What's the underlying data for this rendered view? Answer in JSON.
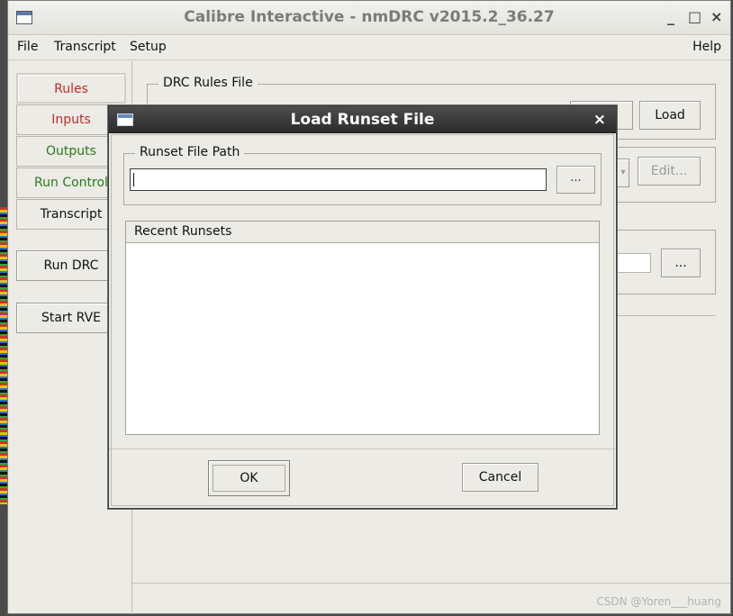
{
  "window": {
    "title": "Calibre Interactive - nmDRC v2015.2_36.27",
    "minimize": "_",
    "maximize": "□",
    "close": "×"
  },
  "menubar": {
    "file": "File",
    "transcript": "Transcript",
    "setup": "Setup",
    "help": "Help"
  },
  "nav": {
    "rules": "Rules",
    "inputs": "Inputs",
    "outputs": "Outputs",
    "run_control": "Run Control",
    "transcript": "Transcript",
    "run_drc": "Run DRC",
    "start_rve": "Start RVE"
  },
  "content": {
    "drc_rules_legend": "DRC Rules File",
    "load_button": "Load",
    "edit_button": "Edit...",
    "browse_button": "..."
  },
  "dialog": {
    "title": "Load Runset File",
    "close": "×",
    "path_legend": "Runset File Path",
    "path_value": "",
    "browse_button": "...",
    "recent_header": "Recent Runsets",
    "recent_items": [],
    "ok_button": "OK",
    "cancel_button": "Cancel"
  },
  "watermark": "CSDN @Yoren___huang",
  "colors": {
    "window_bg": "#ecebe5",
    "dialog_titlebar": "#2c2c2c",
    "nav_red": "#c22a2a",
    "nav_green": "#2b7a1f"
  }
}
